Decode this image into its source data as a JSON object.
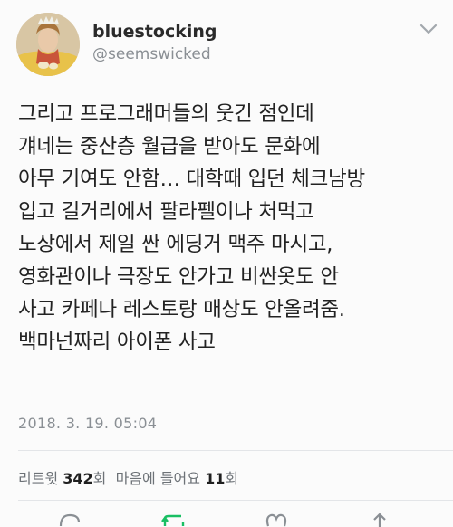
{
  "user": {
    "display_name": "bluestocking",
    "handle": "@seemswicked"
  },
  "tweet": {
    "lines": [
      "그리고 프로그래머들의 웃긴 점인데",
      "걔네는 중산층 월급을 받아도 문화에",
      "아무 기여도 안함… 대학때 입던 체크남방",
      "입고 길거리에서 팔라펠이나 처먹고",
      "노상에서 제일 싼 에딩거 맥주 마시고,",
      "영화관이나 극장도 안가고 비싼옷도 안",
      "사고 카페나 레스토랑 매상도 안올려줌.",
      "백마넌짜리 아이폰 사고"
    ],
    "timestamp": "2018. 3. 19. 05:04"
  },
  "stats": {
    "retweet_label": "리트윗",
    "retweet_count": "342",
    "retweet_unit": "회",
    "like_label": "마음에 들어요",
    "like_count": "11",
    "like_unit": "회"
  },
  "icons": {
    "menu": "chevron-down-icon",
    "actions": [
      "reply-icon",
      "retweet-icon",
      "like-icon",
      "share-icon"
    ]
  },
  "colors": {
    "background": "#fbfbfb",
    "secondary_text": "#8a8f94",
    "retweet_green": "#19bf63",
    "icon_gray": "#8a8f94"
  }
}
